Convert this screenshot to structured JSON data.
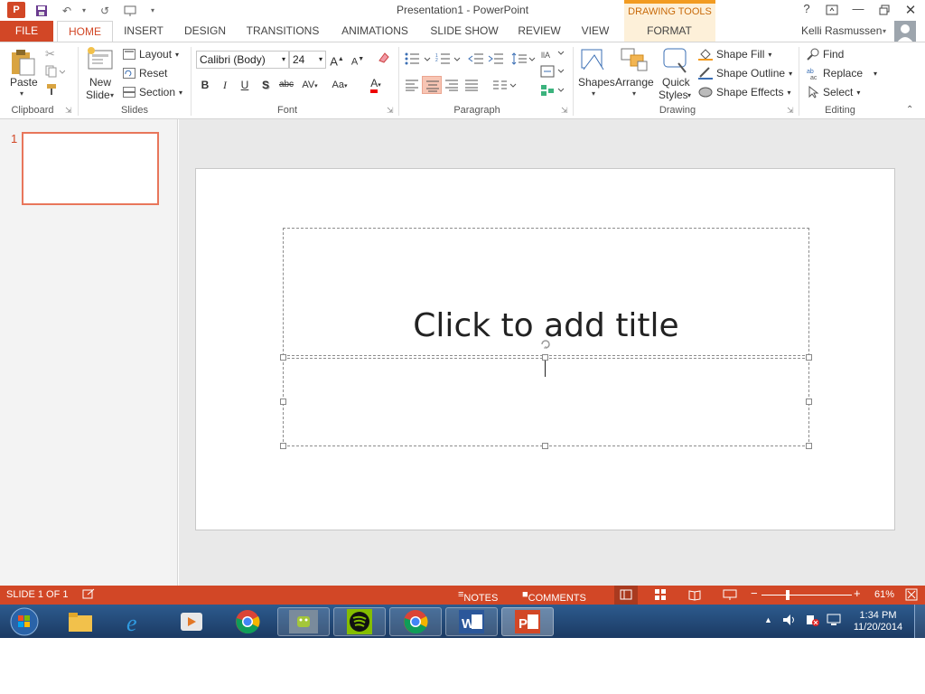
{
  "window": {
    "title": "Presentation1 - PowerPoint",
    "contextual_tab_group": "DRAWING TOOLS"
  },
  "quick_access": {
    "save": "save-icon",
    "undo": "undo-icon",
    "redo": "redo-icon",
    "from_beginning": "present-icon"
  },
  "window_controls": {
    "help": "?",
    "restore_ribbon": "ribbon-display-icon",
    "minimize": "minimize",
    "maximize": "maximize",
    "close": "close"
  },
  "tabs": [
    "FILE",
    "HOME",
    "INSERT",
    "DESIGN",
    "TRANSITIONS",
    "ANIMATIONS",
    "SLIDE SHOW",
    "REVIEW",
    "VIEW",
    "FORMAT"
  ],
  "user": {
    "name": "Kelli Rasmussen"
  },
  "ribbon": {
    "clipboard": {
      "label": "Clipboard",
      "paste": "Paste"
    },
    "slides": {
      "label": "Slides",
      "new_slide_1": "New",
      "new_slide_2": "Slide",
      "layout": "Layout",
      "reset": "Reset",
      "section": "Section"
    },
    "font": {
      "label": "Font",
      "family": "Calibri (Body)",
      "size": "24",
      "bold": "B",
      "italic": "I",
      "underline": "U",
      "shadow": "S",
      "strike": "abc",
      "spacing": "AV",
      "case": "Aa",
      "color_letter": "A",
      "grow": "A",
      "shrink": "A"
    },
    "paragraph": {
      "label": "Paragraph"
    },
    "drawing": {
      "label": "Drawing",
      "shapes": "Shapes",
      "arrange": "Arrange",
      "quick_styles_1": "Quick",
      "quick_styles_2": "Styles",
      "shape_fill": "Shape Fill",
      "shape_outline": "Shape Outline",
      "shape_effects": "Shape Effects"
    },
    "editing": {
      "label": "Editing",
      "find": "Find",
      "replace": "Replace",
      "select": "Select"
    }
  },
  "thumbnail": {
    "number": "1"
  },
  "slide": {
    "title_placeholder": "Click to add title"
  },
  "status_bar": {
    "slide_info": "SLIDE 1 OF 1",
    "notes": "NOTES",
    "comments": "COMMENTS",
    "zoom": "61%",
    "zoom_level": 0.61
  },
  "taskbar": {
    "apps": [
      "windows-start",
      "file-explorer",
      "internet-explorer",
      "media-player",
      "chrome",
      "android-tool",
      "spotify",
      "chrome",
      "word",
      "powerpoint"
    ],
    "time": "1:34 PM",
    "date": "11/20/2014"
  },
  "colors": {
    "accent": "#d24726",
    "tab_text": "#444444",
    "status_bg": "#d24726",
    "contextual": "#f29b21"
  }
}
